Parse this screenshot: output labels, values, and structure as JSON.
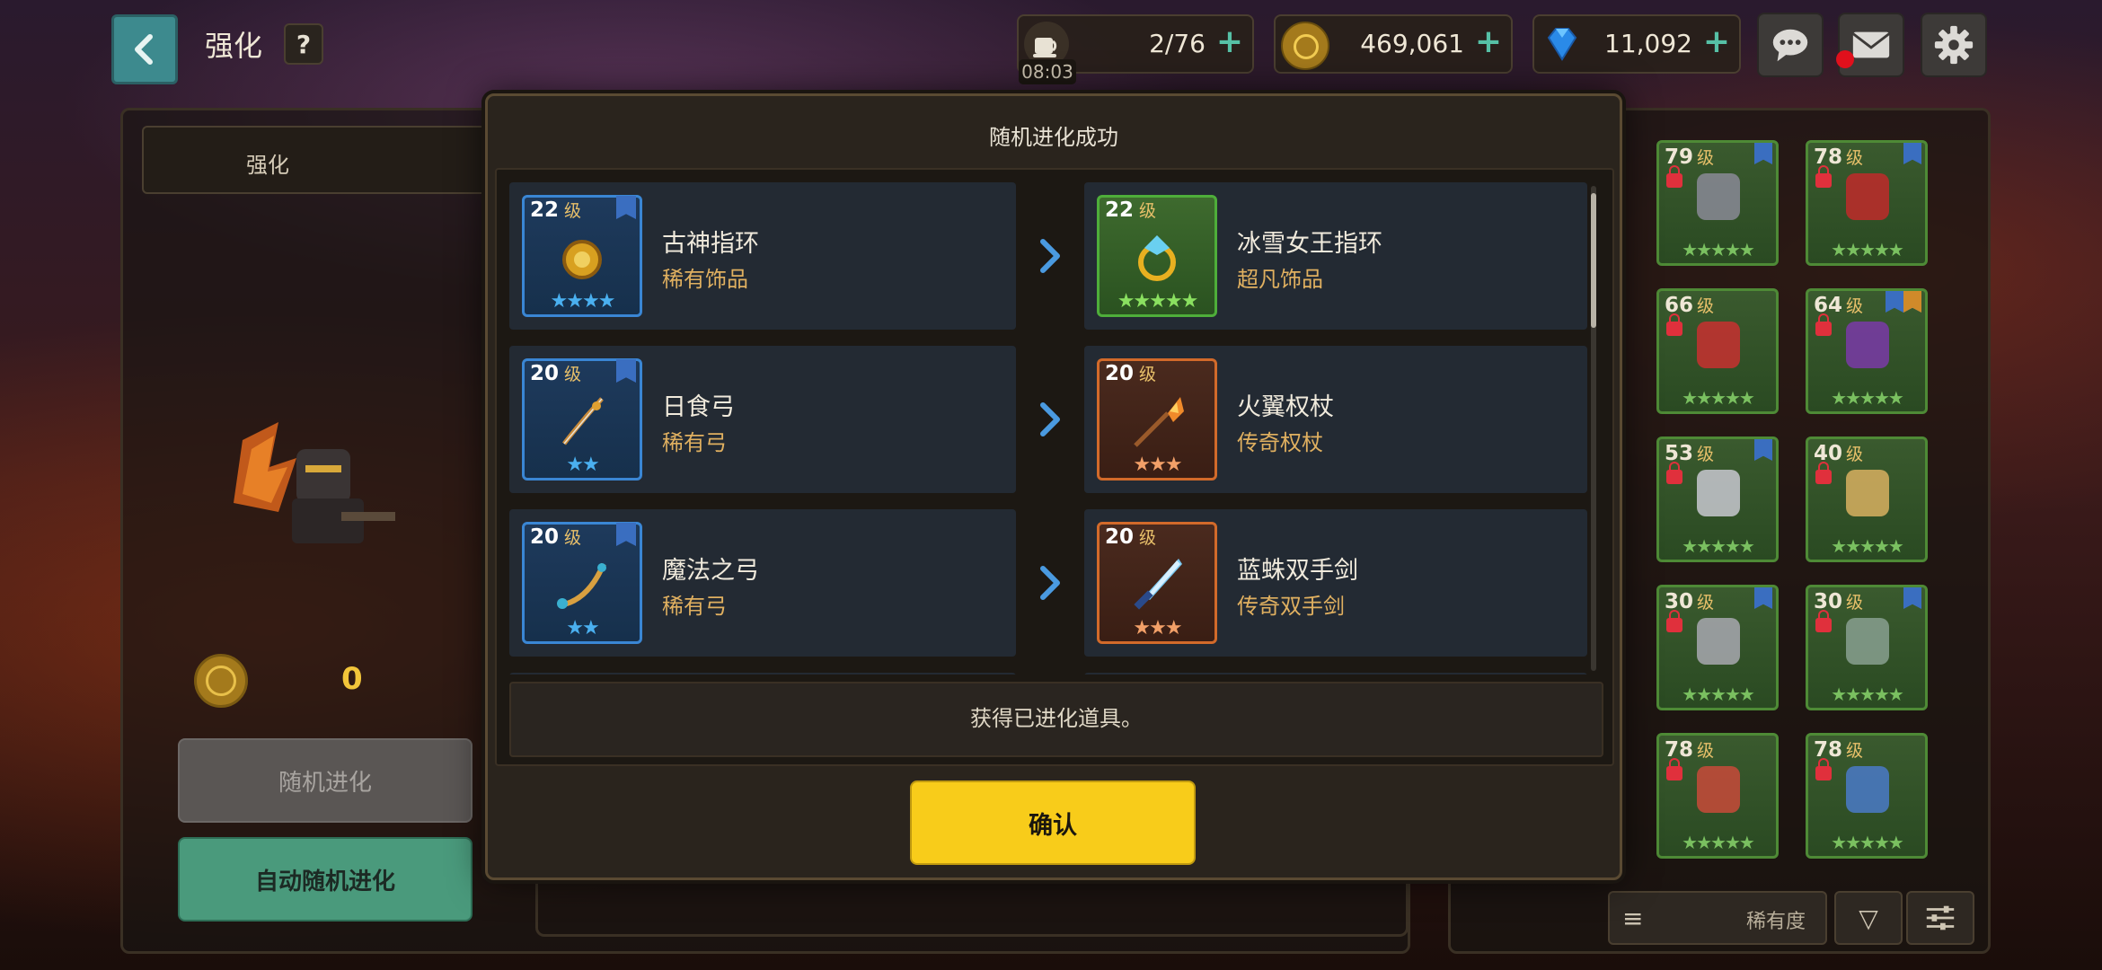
{
  "header": {
    "title": "强化",
    "help_label": "?",
    "stamina": {
      "value": "2/76",
      "timer": "08:03"
    },
    "gold": {
      "value": "469,061"
    },
    "gems": {
      "value": "11,092"
    }
  },
  "left_panel": {
    "tab_label": "强化",
    "coin_cost": "0",
    "random_evolve_label": "随机进化",
    "auto_random_evolve_label": "自动随机进化"
  },
  "inventory": {
    "items": [
      {
        "level": "79",
        "unit": "级",
        "stars": "★★★★★"
      },
      {
        "level": "78",
        "unit": "级",
        "stars": "★★★★★"
      },
      {
        "level": "66",
        "unit": "级",
        "stars": "★★★★★"
      },
      {
        "level": "64",
        "unit": "级",
        "stars": "★★★★★"
      },
      {
        "level": "53",
        "unit": "级",
        "stars": "★★★★★"
      },
      {
        "level": "40",
        "unit": "级",
        "stars": "★★★★★"
      },
      {
        "level": "30",
        "unit": "级",
        "stars": "★★★★★"
      },
      {
        "level": "30",
        "unit": "级",
        "stars": "★★★★★"
      },
      {
        "level": "78",
        "unit": "级",
        "stars": "★★★★★"
      },
      {
        "level": "78",
        "unit": "级",
        "stars": "★★★★★"
      }
    ],
    "sort_label": "稀有度",
    "sort_direction_icon": "▽"
  },
  "modal": {
    "title": "随机进化成功",
    "rows": [
      {
        "from": {
          "level": "22",
          "unit": "级",
          "name": "古神指环",
          "type": "稀有饰品",
          "stars": "★★★★"
        },
        "to": {
          "level": "22",
          "unit": "级",
          "name": "冰雪女王指环",
          "type": "超凡饰品",
          "stars": "★★★★★"
        }
      },
      {
        "from": {
          "level": "20",
          "unit": "级",
          "name": "日食弓",
          "type": "稀有弓",
          "stars": "★★"
        },
        "to": {
          "level": "20",
          "unit": "级",
          "name": "火翼权杖",
          "type": "传奇权杖",
          "stars": "★★★"
        }
      },
      {
        "from": {
          "level": "20",
          "unit": "级",
          "name": "魔法之弓",
          "type": "稀有弓",
          "stars": "★★"
        },
        "to": {
          "level": "20",
          "unit": "级",
          "name": "蓝蛛双手剑",
          "type": "传奇双手剑",
          "stars": "★★★"
        }
      }
    ],
    "footer_text": "获得已进化道具。",
    "confirm_label": "确认"
  }
}
